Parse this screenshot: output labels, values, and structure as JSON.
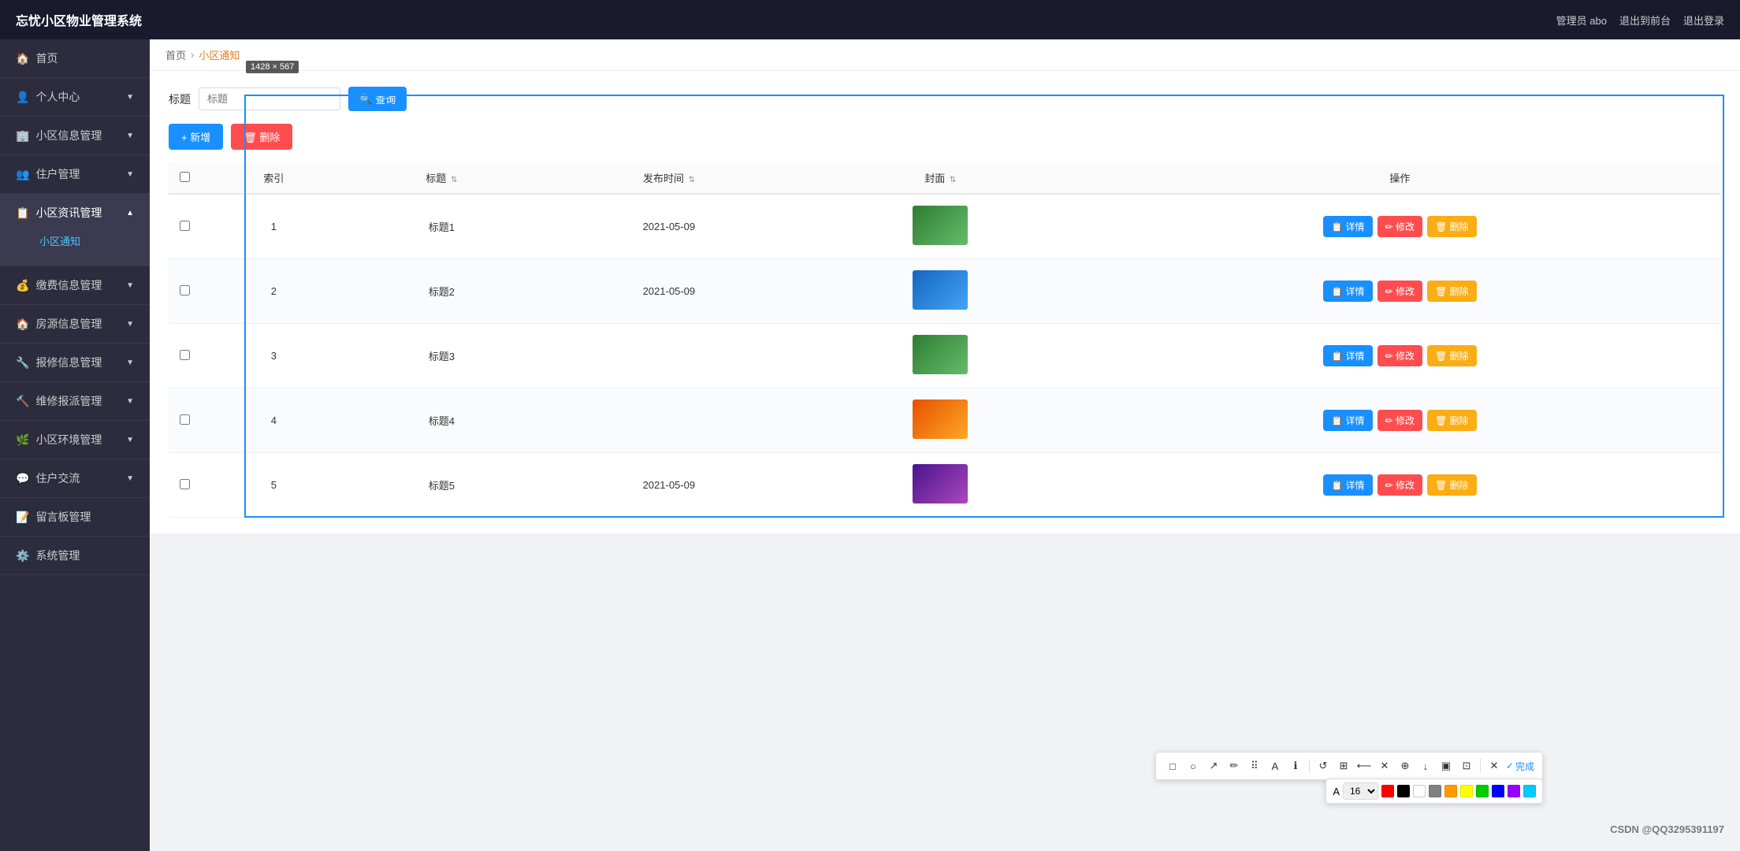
{
  "app": {
    "title": "忘忧小区物业管理系统",
    "admin": "管理员 abo",
    "back": "退出到前台",
    "logout": "退出登录"
  },
  "sidebar": {
    "items": [
      {
        "label": "首页",
        "icon": "🏠",
        "active": false
      },
      {
        "label": "个人中心",
        "icon": "👤",
        "active": false
      },
      {
        "label": "小区信息管理",
        "icon": "🏢",
        "active": false
      },
      {
        "label": "住户管理",
        "icon": "👥",
        "active": false
      },
      {
        "label": "小区资讯管理",
        "icon": "📋",
        "active": true,
        "sub": [
          "小区通知"
        ]
      },
      {
        "label": "缴费信息管理",
        "icon": "💰",
        "active": false
      },
      {
        "label": "房源信息管理",
        "icon": "🏠",
        "active": false
      },
      {
        "label": "报修信息管理",
        "icon": "🔧",
        "active": false
      },
      {
        "label": "维修报派管理",
        "icon": "🔨",
        "active": false
      },
      {
        "label": "小区环境管理",
        "icon": "🌿",
        "active": false
      },
      {
        "label": "住户交流",
        "icon": "💬",
        "active": false
      },
      {
        "label": "留言板管理",
        "icon": "📝",
        "active": false
      },
      {
        "label": "系统管理",
        "icon": "⚙️",
        "active": false
      }
    ]
  },
  "breadcrumb": {
    "home": "首页",
    "current": "小区通知"
  },
  "search": {
    "label": "标题",
    "placeholder": "标题",
    "query_btn": "查询"
  },
  "toolbar": {
    "add_btn": "+ 新增",
    "delete_btn": "删除"
  },
  "table": {
    "columns": [
      "索引",
      "标题",
      "发布时间",
      "封面",
      "操作"
    ],
    "rows": [
      {
        "index": 1,
        "title": "标题1",
        "date": "2021-05-09",
        "cover_color": "green"
      },
      {
        "index": 2,
        "title": "标题2",
        "date": "2021-05-09",
        "cover_color": "blue"
      },
      {
        "index": 3,
        "title": "标题3",
        "date": "",
        "cover_color": "green"
      },
      {
        "index": 4,
        "title": "标题4",
        "date": "",
        "cover_color": "orange"
      },
      {
        "index": 5,
        "title": "标题5",
        "date": "2021-05-09",
        "cover_color": "purple"
      }
    ],
    "op_detail": "详情",
    "op_edit": "修改",
    "op_delete": "删除"
  },
  "dimension_tag": "1428 × 567",
  "annotation": {
    "tools": [
      "□",
      "○",
      "↗",
      "✏",
      "⠿",
      "A",
      "ℹ",
      "↺",
      "⊞",
      "⟵",
      "✕",
      "⊕",
      "↓",
      "▣",
      "⊡",
      "✕"
    ],
    "done": "完成",
    "font_size": "16",
    "colors": [
      "#ff0000",
      "#000000",
      "#ffffff",
      "#808080",
      "#ff9900",
      "#ffff00",
      "#00cc00",
      "#0000ff",
      "#9900ff",
      "#00ccff"
    ]
  },
  "csdn_watermark": "CSDN @QQ3295391197"
}
